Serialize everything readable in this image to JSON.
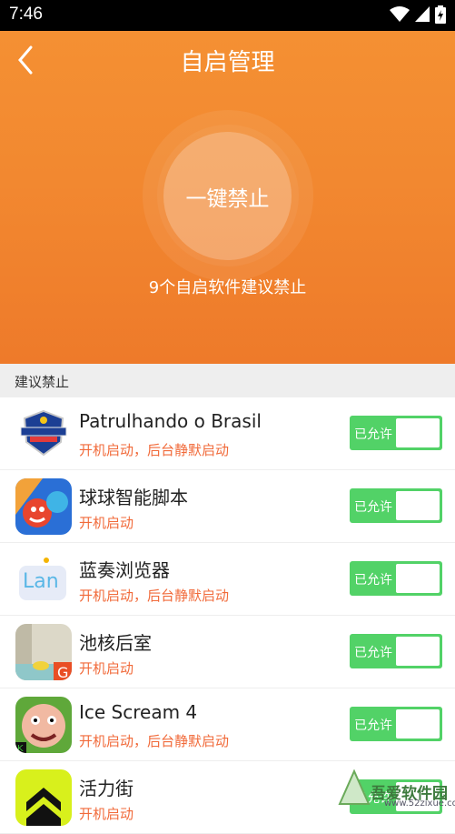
{
  "status_bar": {
    "time": "7:46"
  },
  "header": {
    "title": "自启管理",
    "action_label": "一键禁止",
    "summary": "9个自启软件建议禁止"
  },
  "section_label": "建议禁止",
  "apps": [
    {
      "name": "Patrulhando o Brasil",
      "status": "开机启动，后台静默启动",
      "toggle_label": "已允许",
      "icon": "patrulhando-badge-icon"
    },
    {
      "name": "球球智能脚本",
      "status": "开机启动",
      "toggle_label": "已允许",
      "icon": "game-character-icon"
    },
    {
      "name": "蓝奏浏览器",
      "status": "开机启动，后台静默启动",
      "toggle_label": "已允许",
      "icon": "lanzou-browser-icon"
    },
    {
      "name": "池核后室",
      "status": "开机启动",
      "toggle_label": "已允许",
      "icon": "poolrooms-icon"
    },
    {
      "name": "Ice Scream 4",
      "status": "开机启动，后台静默启动",
      "toggle_label": "已允许",
      "icon": "ice-scream-icon"
    },
    {
      "name": "活力街",
      "status": "开机启动",
      "toggle_label": "已允许",
      "icon": "chevron-app-icon"
    }
  ],
  "watermark": {
    "text": "吾爱软件园",
    "url": "www.52zixue.com"
  },
  "colors": {
    "accent": "#f28830",
    "toggle": "#52d267",
    "status_text": "#f16a3a"
  }
}
